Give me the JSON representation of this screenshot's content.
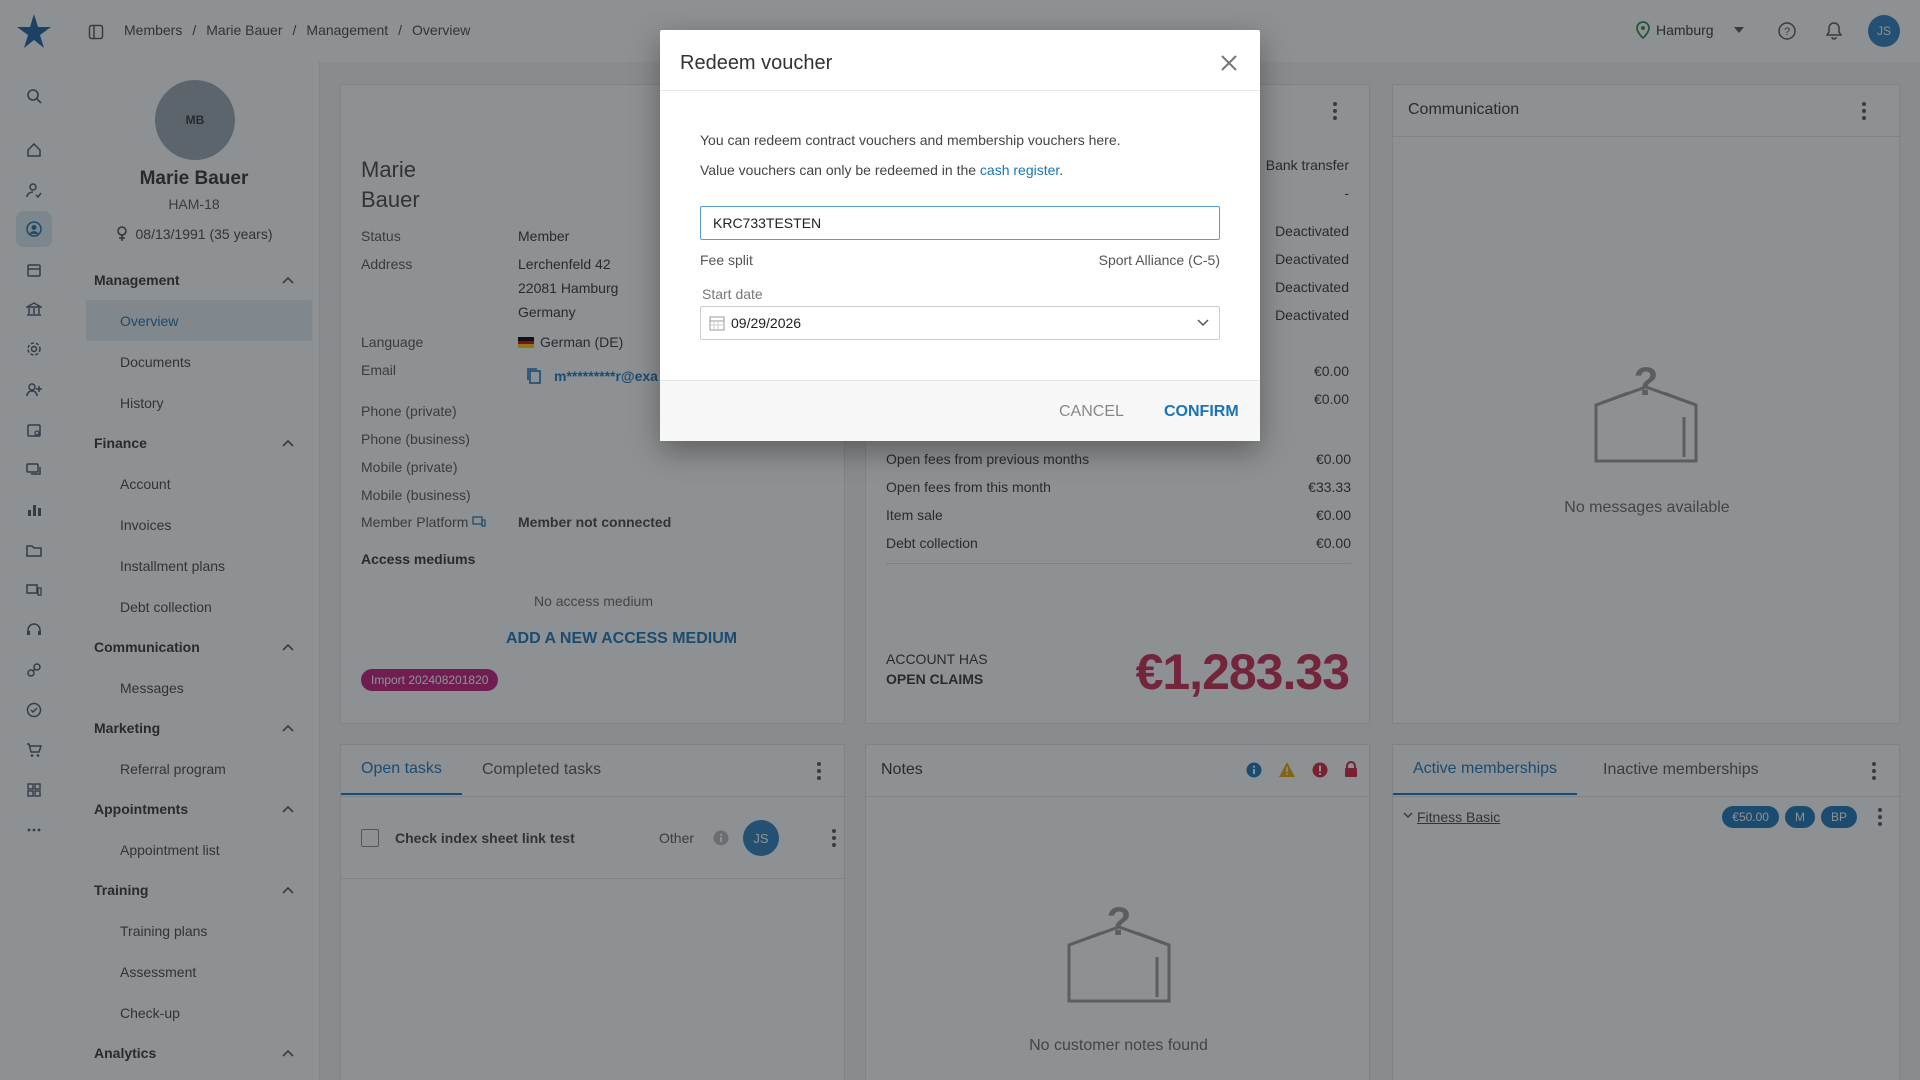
{
  "topbar": {
    "breadcrumb": [
      "Members",
      "Marie Bauer",
      "Management",
      "Overview"
    ],
    "separator": "/",
    "location": "Hamburg",
    "user_initials": "JS"
  },
  "profile": {
    "avatar_initials": "MB",
    "name": "Marie Bauer",
    "member_id": "HAM-18",
    "birthday": "08/13/1991 (35 years)"
  },
  "sidebar": {
    "sections": [
      {
        "title": "Management",
        "items": [
          "Overview",
          "Documents",
          "History"
        ]
      },
      {
        "title": "Finance",
        "items": [
          "Account",
          "Invoices",
          "Installment plans",
          "Debt collection"
        ]
      },
      {
        "title": "Communication",
        "items": [
          "Messages"
        ]
      },
      {
        "title": "Marketing",
        "items": [
          "Referral program"
        ]
      },
      {
        "title": "Appointments",
        "items": [
          "Appointment list"
        ]
      },
      {
        "title": "Training",
        "items": [
          "Training plans",
          "Assessment",
          "Check-up"
        ]
      },
      {
        "title": "Analytics",
        "items": []
      }
    ],
    "active_item": "Overview"
  },
  "member_card": {
    "first_name": "Marie",
    "last_name": "Bauer",
    "status_label": "Status",
    "status_value": "Member",
    "address_label": "Address",
    "address_lines": [
      "Lerchenfeld 42",
      "22081 Hamburg",
      "Germany"
    ],
    "language_label": "Language",
    "language_value": "German (DE)",
    "email_label": "Email",
    "email_value": "m*********r@exa",
    "phone_private": "Phone (private)",
    "phone_business": "Phone (business)",
    "mobile_private": "Mobile (private)",
    "mobile_business": "Mobile (business)",
    "platform_label": "Member Platform",
    "platform_value": "Member not connected",
    "access_title": "Access mediums",
    "access_empty": "No access medium",
    "access_add": "ADD A NEW ACCESS MEDIUM",
    "import_tag": "Import 202408201820"
  },
  "finance_card": {
    "payment_method": "Bank transfer",
    "dash": "-",
    "deactivated": [
      "Deactivated",
      "Deactivated",
      "Deactivated",
      "Deactivated"
    ],
    "amounts_top": [
      "€0.00",
      "€0.00"
    ],
    "rows": [
      {
        "label": "Open fees from previous months",
        "value": "€0.00"
      },
      {
        "label": "Open fees from this month",
        "value": "€33.33"
      },
      {
        "label": "Item sale",
        "value": "€0.00"
      },
      {
        "label": "Debt collection",
        "value": "€0.00"
      }
    ],
    "claims_line1": "ACCOUNT HAS",
    "claims_line2": "OPEN CLAIMS",
    "claims_amount": "€1,283.33"
  },
  "communication_card": {
    "title": "Communication",
    "empty": "No messages available"
  },
  "tasks_card": {
    "tab_open": "Open tasks",
    "tab_completed": "Completed tasks",
    "task_label": "Check index sheet link test",
    "task_category": "Other",
    "task_assignee": "JS"
  },
  "notes_card": {
    "title": "Notes",
    "empty": "No customer notes found"
  },
  "memberships_card": {
    "tab_active": "Active memberships",
    "tab_inactive": "Inactive memberships",
    "membership_name": "Fitness Basic",
    "price_badge": "€50.00",
    "badge_m": "M",
    "badge_bp": "BP"
  },
  "dialog": {
    "title": "Redeem voucher",
    "info_line1": "You can redeem contract vouchers and membership vouchers here.",
    "info_line2_prefix": "Value vouchers can only be redeemed in the",
    "info_line2_link": "cash register",
    "info_line2_suffix": ".",
    "voucher_code": "KRC733TESTEN",
    "fee_split_label": "Fee split",
    "fee_split_value": "Sport Alliance (C-5)",
    "start_date_label": "Start date",
    "start_date_value": "09/29/2026",
    "cancel": "CANCEL",
    "confirm": "CONFIRM"
  },
  "colors": {
    "primary": "#1a73b8",
    "claims_red": "#c8264f",
    "import_tag": "#c2187c"
  }
}
